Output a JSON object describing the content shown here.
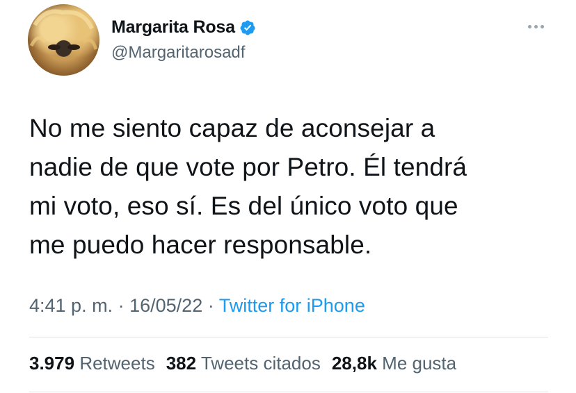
{
  "author": {
    "display_name": "Margarita Rosa",
    "handle": "@Margaritarosadf",
    "verified": true
  },
  "tweet": {
    "lines": [
      "No me siento capaz de aconsejar a",
      "nadie de que vote por Petro. Él tendrá",
      "mi voto, eso sí. Es del único voto que",
      "me puedo hacer responsable."
    ],
    "time": "4:41 p. m.",
    "date": "16/05/22",
    "separator": "·",
    "source": "Twitter for iPhone"
  },
  "stats": {
    "retweets_count": "3.979",
    "retweets_label": "Retweets",
    "quotes_count": "382",
    "quotes_label": "Tweets citados",
    "likes_count": "28,8k",
    "likes_label": "Me gusta"
  },
  "colors": {
    "link": "#1d9bf0",
    "secondary_text": "#536471",
    "primary_text": "#0f1419"
  }
}
